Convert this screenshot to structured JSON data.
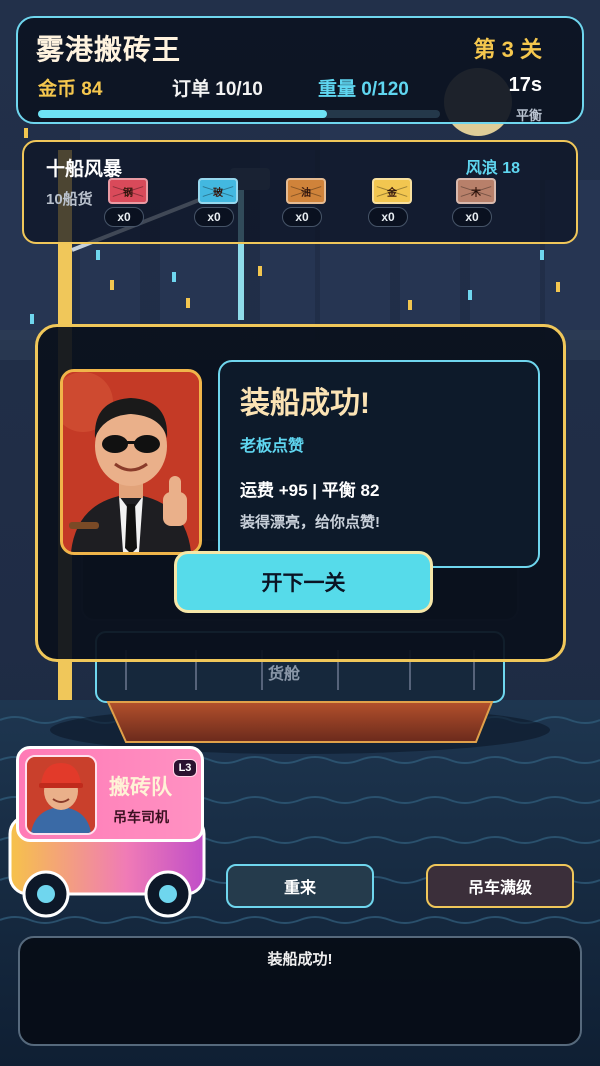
{
  "hud": {
    "title": "雾港搬砖王",
    "level": "第 3 关",
    "coins": "金币 84",
    "orders": "订单 10/10",
    "weight": "重量 0/120",
    "timer": "17s",
    "balance_label": "平衡",
    "progress_fraction": 0.72
  },
  "cargo": {
    "name": "十船风暴",
    "subtitle": "10船货",
    "waves": "风浪 18",
    "items": [
      {
        "label": "钢",
        "count": "x0",
        "color": "#d94a5a",
        "icon": "steel-crate-icon"
      },
      {
        "label": "玻",
        "count": "x0",
        "color": "#43b8e0",
        "icon": "glass-crate-icon"
      },
      {
        "label": "油",
        "count": "x0",
        "color": "#d0833a",
        "icon": "oil-crate-icon"
      },
      {
        "label": "金",
        "count": "x0",
        "color": "#f2c650",
        "icon": "gold-crate-icon"
      },
      {
        "label": "木",
        "count": "x0",
        "color": "#b8806a",
        "icon": "wood-crate-icon"
      }
    ]
  },
  "ship": {
    "hold_label": "货舱"
  },
  "modal": {
    "headline": "装船成功!",
    "tag": "老板点赞",
    "stats": "运费 +95  |  平衡 82",
    "quote": "装得漂亮，给你点赞!",
    "next_button": "开下一关"
  },
  "team": {
    "name": "搬砖队",
    "role": "吊车司机",
    "level": "L3"
  },
  "buttons": {
    "retry": "重来",
    "crane_max": "吊车满级"
  },
  "log": {
    "message": "装船成功!"
  },
  "colors": {
    "accent_cyan": "#6fd6ee",
    "accent_gold": "#f0c75a",
    "team_pink": "#ff7ab6"
  }
}
